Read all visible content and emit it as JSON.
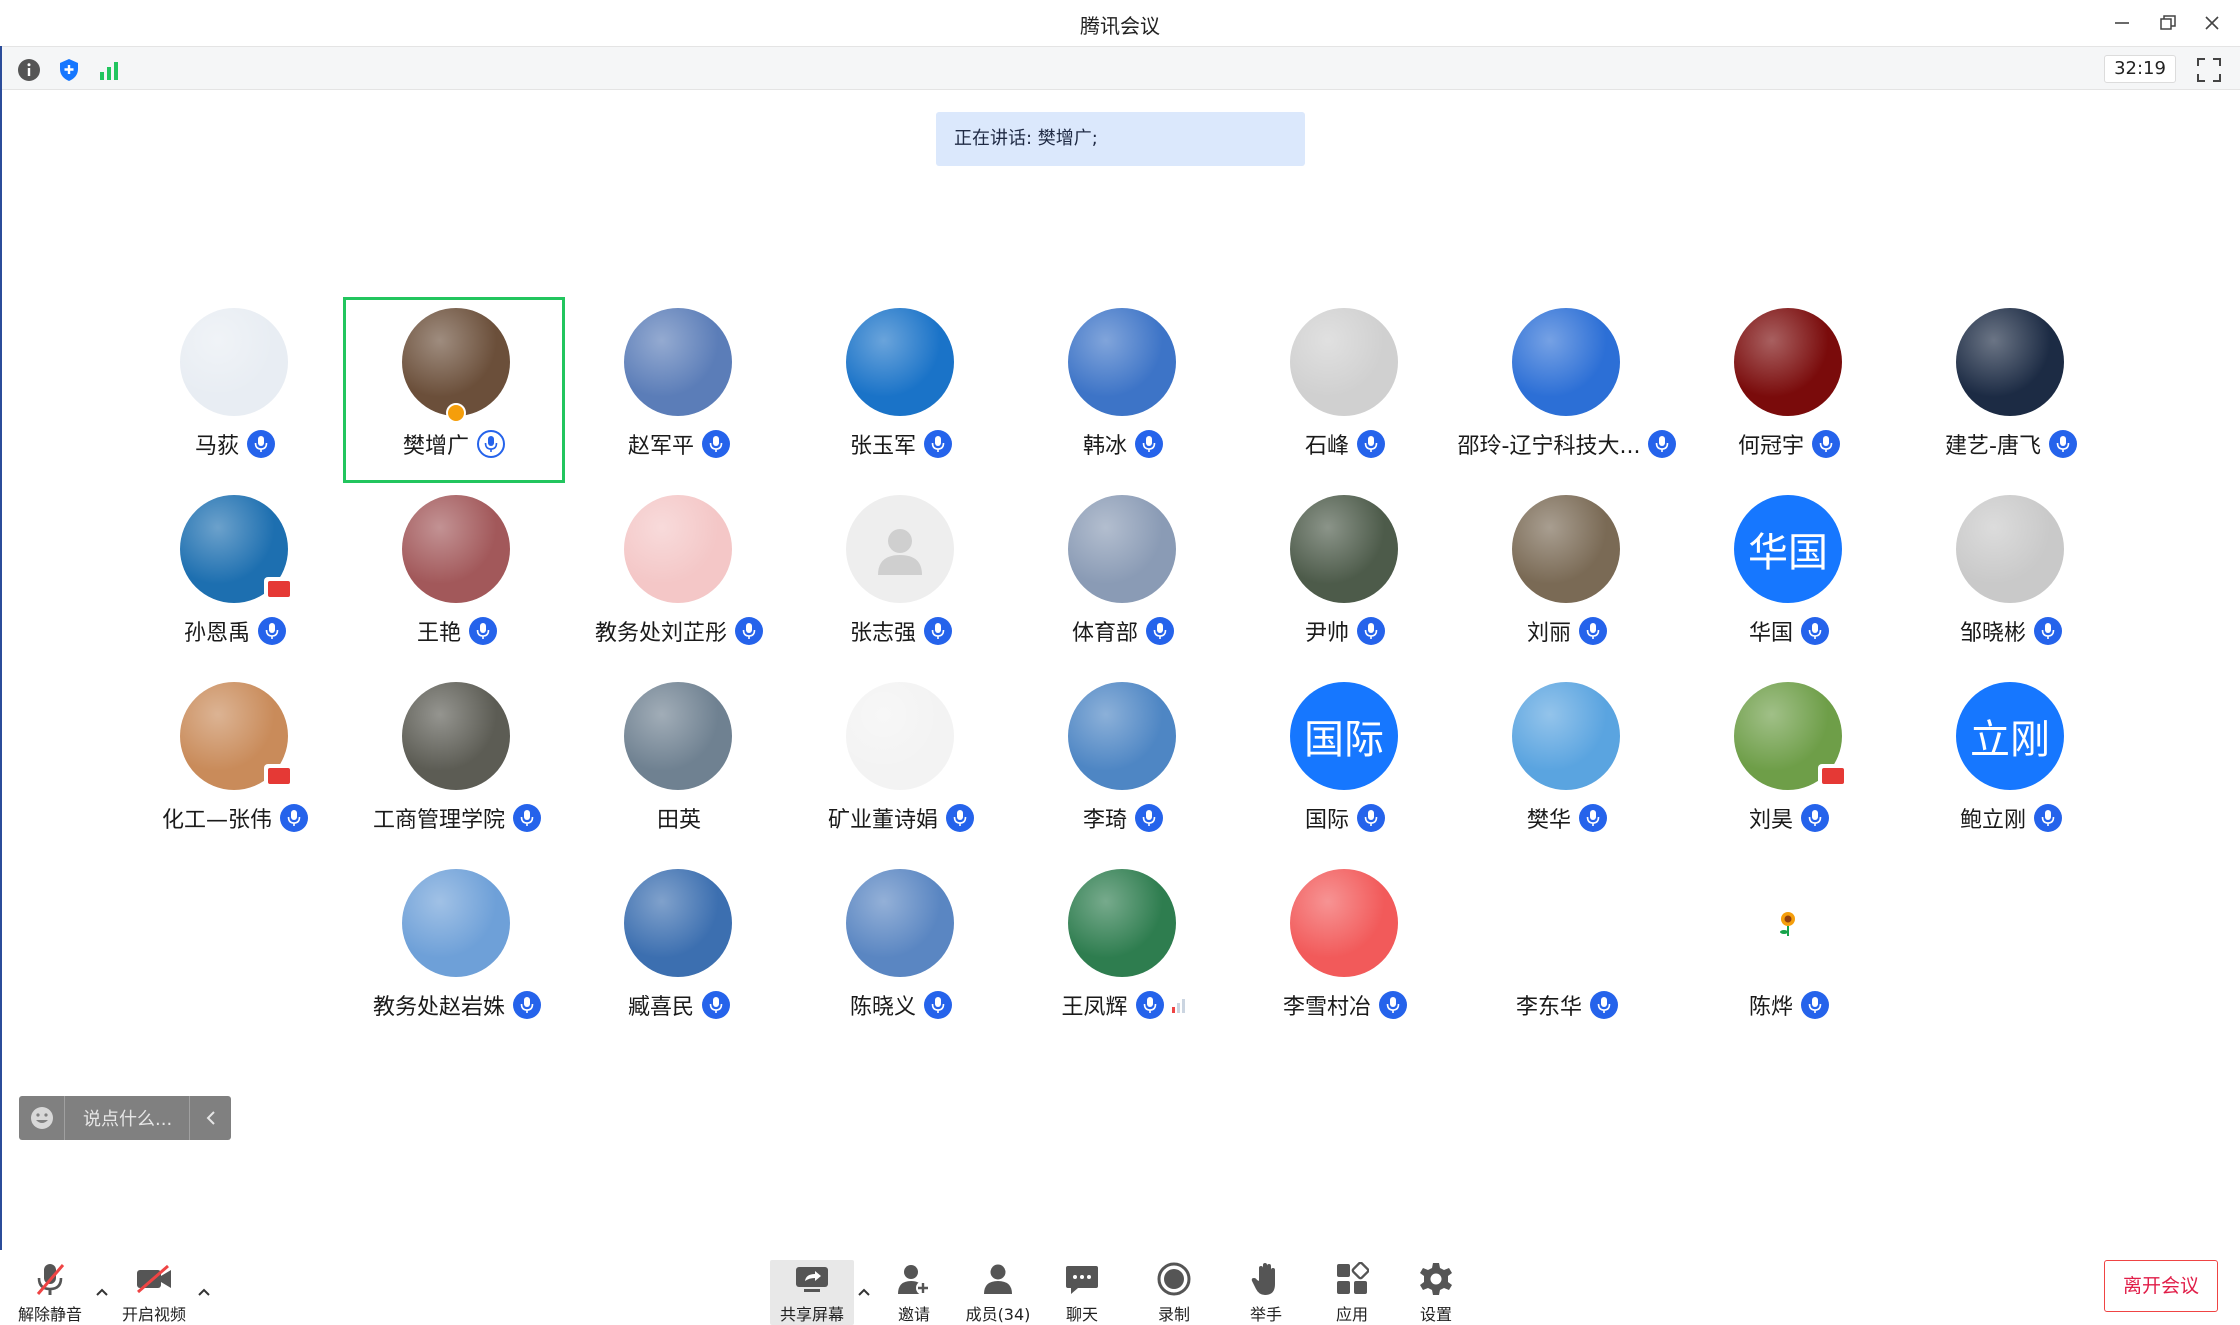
{
  "window": {
    "title": "腾讯会议",
    "timer": "32:19"
  },
  "speaking": {
    "text": "正在讲话: 樊增广;"
  },
  "participants": [
    {
      "name": "马荻",
      "row": 0,
      "col": 0,
      "avatar": "person-cartoon",
      "bg": "#e8edf3",
      "mic": "blue"
    },
    {
      "name": "樊增广",
      "row": 0,
      "col": 1,
      "avatar": "tea-cup",
      "bg": "#6b4f3a",
      "mic": "white",
      "active": true,
      "host": true
    },
    {
      "name": "赵军平",
      "row": 0,
      "col": 2,
      "avatar": "landscape",
      "bg": "#5b7db8",
      "mic": "blue"
    },
    {
      "name": "张玉军",
      "row": 0,
      "col": 3,
      "avatar": "jumper",
      "bg": "#1a73c8",
      "mic": "blue"
    },
    {
      "name": "韩冰",
      "row": 0,
      "col": 4,
      "avatar": "sky",
      "bg": "#3d74c7",
      "mic": "blue"
    },
    {
      "name": "石峰",
      "row": 0,
      "col": 5,
      "avatar": "ink",
      "bg": "#d0d0d0",
      "mic": "blue"
    },
    {
      "name": "邵玲-辽宁科技大...",
      "row": 0,
      "col": 6,
      "avatar": "flower-tiles",
      "bg": "#2c6fd6",
      "mic": "blue"
    },
    {
      "name": "何冠宇",
      "row": 0,
      "col": 7,
      "avatar": "dark-red",
      "bg": "#7a0b0b",
      "mic": "blue"
    },
    {
      "name": "建艺-唐飞",
      "row": 0,
      "col": 8,
      "avatar": "night",
      "bg": "#1c2b44",
      "mic": "blue"
    },
    {
      "name": "孙恩禹",
      "row": 1,
      "col": 0,
      "avatar": "sea",
      "bg": "#1d6fb0",
      "mic": "blue",
      "flag": true
    },
    {
      "name": "王艳",
      "row": 1,
      "col": 1,
      "avatar": "woman",
      "bg": "#a2585a",
      "mic": "blue"
    },
    {
      "name": "教务处刘芷彤",
      "row": 1,
      "col": 2,
      "avatar": "cartoon-girl",
      "bg": "#f4c7c7",
      "mic": "blue"
    },
    {
      "name": "张志强",
      "row": 1,
      "col": 3,
      "avatar": "default",
      "bg": "#eeeeee",
      "mic": "blue"
    },
    {
      "name": "体育部",
      "row": 1,
      "col": 4,
      "avatar": "beach",
      "bg": "#8a9bb5",
      "mic": "blue"
    },
    {
      "name": "尹帅",
      "row": 1,
      "col": 5,
      "avatar": "child",
      "bg": "#4d5b4a",
      "mic": "blue"
    },
    {
      "name": "刘丽",
      "row": 1,
      "col": 6,
      "avatar": "blossom",
      "bg": "#7a6a55",
      "mic": "blue"
    },
    {
      "name": "华国",
      "row": 1,
      "col": 7,
      "avatar": "text",
      "avatar_text": "华国",
      "bg": "#1677ff",
      "mic": "blue"
    },
    {
      "name": "邹晓彬",
      "row": 1,
      "col": 8,
      "avatar": "boy",
      "bg": "#c9c9c9",
      "mic": "blue"
    },
    {
      "name": "化工—张伟",
      "row": 2,
      "col": 0,
      "avatar": "doraemon",
      "bg": "#c98b5a",
      "mic": "blue",
      "flag": true
    },
    {
      "name": "工商管理学院",
      "row": 2,
      "col": 1,
      "avatar": "man-outdoor",
      "bg": "#5c5c54",
      "mic": "blue"
    },
    {
      "name": "田英",
      "row": 2,
      "col": 2,
      "avatar": "city",
      "bg": "#6f8191",
      "mic": "none"
    },
    {
      "name": "矿业董诗娟",
      "row": 2,
      "col": 3,
      "avatar": "dancer",
      "bg": "#f3f3f3",
      "mic": "blue"
    },
    {
      "name": "李琦",
      "row": 2,
      "col": 4,
      "avatar": "autumn",
      "bg": "#4e86c4",
      "mic": "blue"
    },
    {
      "name": "国际",
      "row": 2,
      "col": 5,
      "avatar": "text",
      "avatar_text": "国际",
      "bg": "#1677ff",
      "mic": "blue"
    },
    {
      "name": "樊华",
      "row": 2,
      "col": 6,
      "avatar": "lake-person",
      "bg": "#5aa4e0",
      "mic": "blue"
    },
    {
      "name": "刘昊",
      "row": 2,
      "col": 7,
      "avatar": "trees",
      "bg": "#6e9e48",
      "mic": "blue",
      "flag": true
    },
    {
      "name": "鲍立刚",
      "row": 2,
      "col": 8,
      "avatar": "text",
      "avatar_text": "立刚",
      "bg": "#1677ff",
      "mic": "blue"
    },
    {
      "name": "教务处赵岩姝",
      "row": 3,
      "col": 1,
      "avatar": "sunflower",
      "bg": "#6ea0d8",
      "mic": "blue"
    },
    {
      "name": "臧喜民",
      "row": 3,
      "col": 2,
      "avatar": "field",
      "bg": "#3c6fb0",
      "mic": "blue"
    },
    {
      "name": "陈晓义",
      "row": 3,
      "col": 3,
      "avatar": "white-blossom",
      "bg": "#5a86c2",
      "mic": "blue"
    },
    {
      "name": "王凤辉",
      "row": 3,
      "col": 4,
      "avatar": "court",
      "bg": "#2e7d4f",
      "mic": "blue",
      "signal": true
    },
    {
      "name": "李雪村冶",
      "row": 3,
      "col": 5,
      "avatar": "luffy",
      "bg": "#f25a5a",
      "mic": "blue"
    },
    {
      "name": "李东华",
      "row": 3,
      "col": 6,
      "avatar": "penguins",
      "bg": "#ffffff",
      "mic": "blue"
    },
    {
      "name": "陈烨",
      "row": 3,
      "col": 7,
      "avatar": "small-flower",
      "bg": "#ffffff",
      "mic": "blue"
    }
  ],
  "chat": {
    "placeholder": "说点什么..."
  },
  "toolbar": {
    "unmute": "解除静音",
    "start_video": "开启视频",
    "share": "共享屏幕",
    "invite": "邀请",
    "members": "成员(34)",
    "chat": "聊天",
    "record": "录制",
    "raise_hand": "举手",
    "apps": "应用",
    "settings": "设置",
    "leave": "离开会议"
  },
  "colors": {
    "accent": "#2563eb",
    "active_border": "#22c55e",
    "banner_bg": "#dbe8fc",
    "leave": "#e11d48"
  }
}
